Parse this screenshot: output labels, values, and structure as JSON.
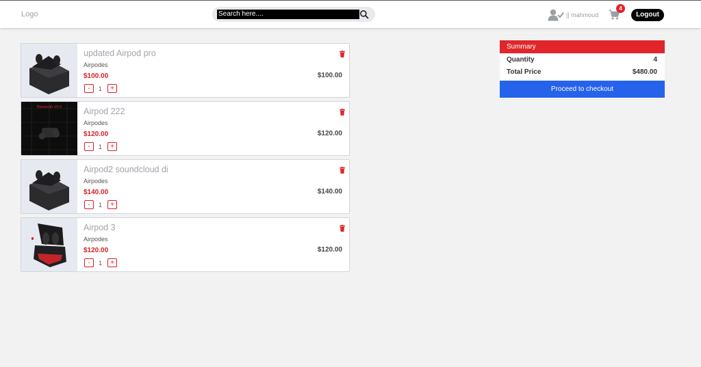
{
  "header": {
    "logo": "Logo",
    "search_placeholder": "Search here....",
    "username": "|| mahmoud",
    "cart_count": "4",
    "logout_label": "Logout"
  },
  "cart": {
    "items": [
      {
        "name": "updated Airpod pro",
        "category": "Airpodes",
        "price": "$100.00",
        "quantity": "1",
        "total": "$100.00",
        "minus": "-",
        "plus": "+"
      },
      {
        "name": "Airpod 222",
        "category": "Airpodes",
        "price": "$120.00",
        "quantity": "1",
        "total": "$120.00",
        "minus": "-",
        "plus": "+",
        "image_text": "Bluetooth V5.0"
      },
      {
        "name": "Airpod2 soundcloud di",
        "category": "Airpodes",
        "price": "$140.00",
        "quantity": "1",
        "total": "$140.00",
        "minus": "-",
        "plus": "+"
      },
      {
        "name": "Airpod 3",
        "category": "Airpodes",
        "price": "$120.00",
        "quantity": "1",
        "total": "$120.00",
        "minus": "-",
        "plus": "+"
      }
    ]
  },
  "summary": {
    "title": "Summary",
    "quantity_label": "Quantity",
    "quantity_value": "4",
    "total_label": "Total Price",
    "total_value": "$480.00",
    "checkout_label": "Proceed to checkout"
  },
  "colors": {
    "accent_red": "#e0262b",
    "checkout_blue": "#2563eb",
    "price_red": "#d61f26"
  }
}
